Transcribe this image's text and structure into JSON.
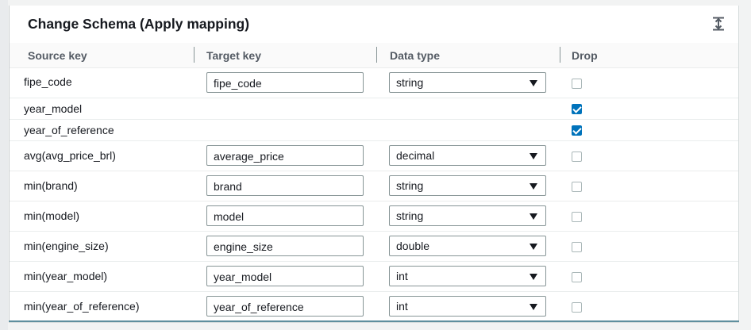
{
  "panel": {
    "title": "Change Schema (Apply mapping)",
    "collapse_icon": "collapse-vertical-icon"
  },
  "columns": {
    "source_key": "Source key",
    "target_key": "Target key",
    "data_type": "Data type",
    "drop": "Drop"
  },
  "rows": [
    {
      "source": "fipe_code",
      "target": "fipe_code",
      "type": "string",
      "drop": false
    },
    {
      "source": "year_model",
      "target": null,
      "type": null,
      "drop": true
    },
    {
      "source": "year_of_reference",
      "target": null,
      "type": null,
      "drop": true
    },
    {
      "source": "avg(avg_price_brl)",
      "target": "average_price",
      "type": "decimal",
      "drop": false
    },
    {
      "source": "min(brand)",
      "target": "brand",
      "type": "string",
      "drop": false
    },
    {
      "source": "min(model)",
      "target": "model",
      "type": "string",
      "drop": false
    },
    {
      "source": "min(engine_size)",
      "target": "engine_size",
      "type": "double",
      "drop": false
    },
    {
      "source": "min(year_model)",
      "target": "year_model",
      "type": "int",
      "drop": false
    },
    {
      "source": "min(year_of_reference)",
      "target": "year_of_reference",
      "type": "int",
      "drop": false
    }
  ],
  "colors": {
    "checkbox_checked": "#0073bb",
    "accent_line": "#5f8f9e"
  }
}
